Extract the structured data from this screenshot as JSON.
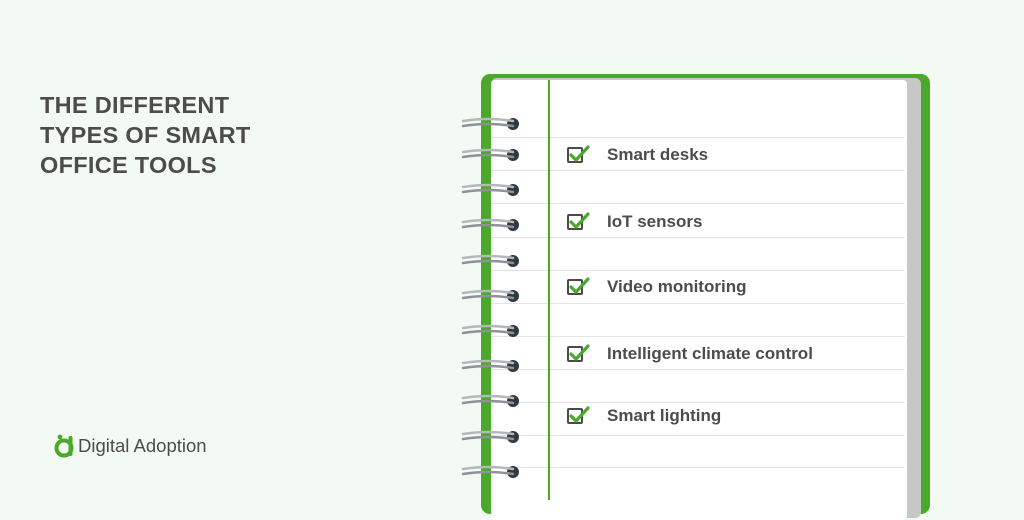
{
  "title": {
    "lines": [
      "THE DIFFERENT",
      "TYPES OF SMART",
      "OFFICE TOOLS"
    ]
  },
  "brand": {
    "name": "Digital Adoption",
    "icon": "digital-adoption-logo-icon"
  },
  "checklist": {
    "items": [
      {
        "label": "Smart desks",
        "checked": true
      },
      {
        "label": "IoT sensors",
        "checked": true
      },
      {
        "label": "Video monitoring",
        "checked": true
      },
      {
        "label": "Intelligent climate control",
        "checked": true
      },
      {
        "label": "Smart lighting",
        "checked": true
      }
    ]
  },
  "colors": {
    "background": "#f3faf3",
    "accent_green": "#4aa82a",
    "text": "#4c4c4c",
    "page": "#ffffff"
  }
}
